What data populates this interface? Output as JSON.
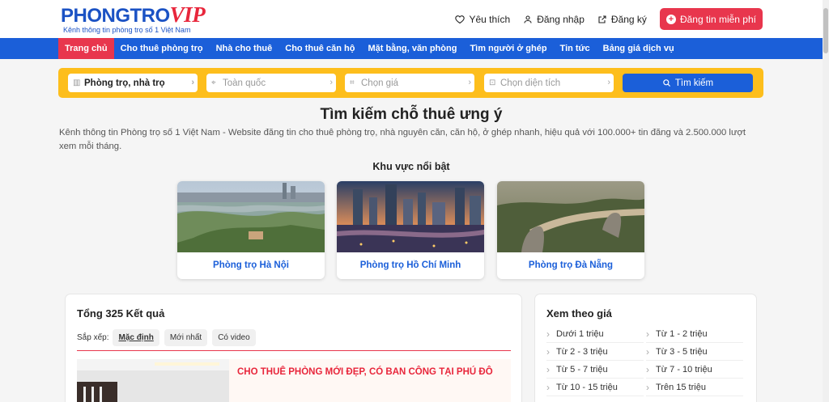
{
  "header": {
    "logo_main_1": "PHONGTRO",
    "logo_main_2": "VIP",
    "logo_sub": "Kênh thông tin phòng trọ số 1 Việt Nam",
    "favorites": "Yêu thích",
    "login": "Đăng nhập",
    "register": "Đăng ký",
    "post_button": "Đăng tin miễn phí"
  },
  "nav": {
    "items": [
      "Trang chủ",
      "Cho thuê phòng trọ",
      "Nhà cho thuê",
      "Cho thuê căn hộ",
      "Mặt bằng, văn phòng",
      "Tìm người ở ghép",
      "Tin tức",
      "Bảng giá dịch vụ"
    ]
  },
  "search": {
    "category": "Phòng trọ, nhà trọ",
    "location": "Toàn quốc",
    "price": "Chọn giá",
    "area": "Chọn diện tích",
    "button": "Tìm kiếm"
  },
  "intro": {
    "title": "Tìm kiếm chỗ thuê ưng ý",
    "text": "Kênh thông tin Phòng trọ số 1 Việt Nam - Website đăng tin cho thuê phòng trọ, nhà nguyên căn, căn hộ, ở ghép nhanh, hiệu quả với 100.000+ tin đăng và 2.500.000 lượt xem mỗi tháng."
  },
  "featured": {
    "title": "Khu vực nổi bật",
    "cities": [
      {
        "label": "Phòng trọ Hà Nội"
      },
      {
        "label": "Phòng trọ Hồ Chí Minh"
      },
      {
        "label": "Phòng trọ Đà Nẵng"
      }
    ]
  },
  "results": {
    "title": "Tổng 325 Kết quả",
    "sort_label": "Sắp xếp:",
    "sort_options": [
      "Mặc định",
      "Mới nhất",
      "Có video"
    ],
    "first_listing_title": "CHO THUÊ PHÒNG MỚI ĐẸP, CÓ BAN CÔNG TẠI PHÚ ĐÔ"
  },
  "price_filter": {
    "title": "Xem theo giá",
    "items": [
      "Dưới 1 triệu",
      "Từ 1 - 2 triệu",
      "Từ 2 - 3 triệu",
      "Từ 3 - 5 triệu",
      "Từ 5 - 7 triệu",
      "Từ 7 - 10 triệu",
      "Từ 10 - 15 triệu",
      "Trên 15 triệu"
    ]
  },
  "colors": {
    "brand_blue": "#1b5fd9",
    "brand_red": "#e8364d",
    "search_yellow": "#fdbe1c"
  }
}
